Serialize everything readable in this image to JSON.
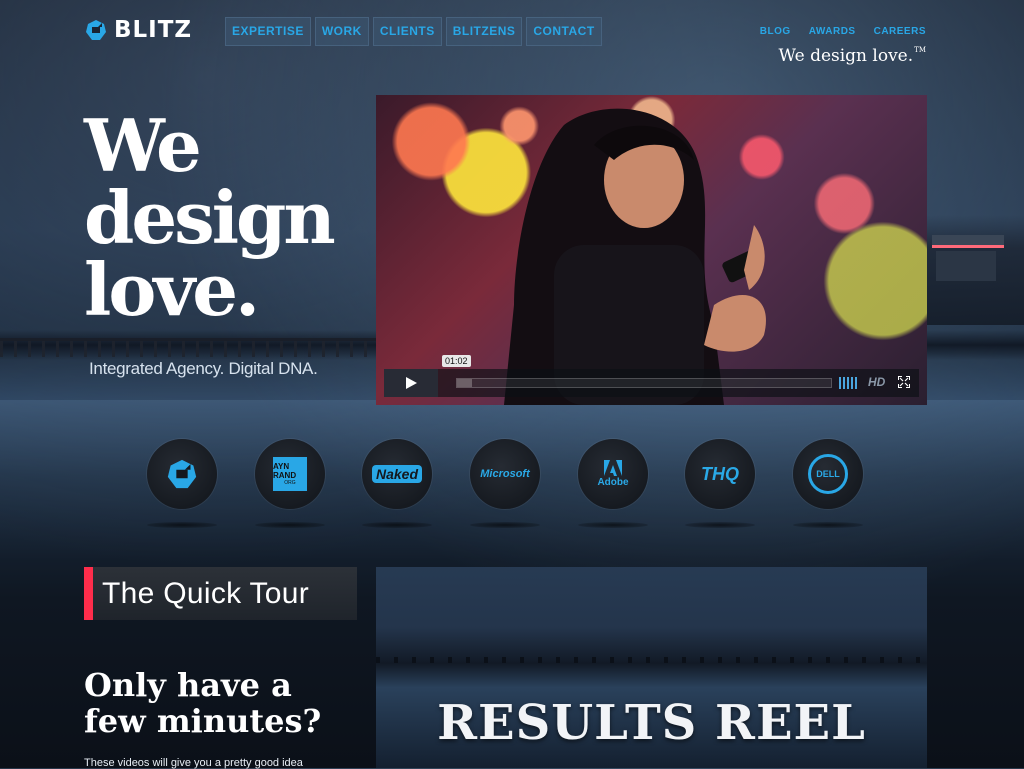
{
  "brand": {
    "name": "BLITZ",
    "tagline": "We design love.",
    "tagline_mark": "TM"
  },
  "nav": {
    "items": [
      {
        "label": "EXPERTISE"
      },
      {
        "label": "WORK"
      },
      {
        "label": "CLIENTS"
      },
      {
        "label": "BLITZENS"
      },
      {
        "label": "CONTACT"
      }
    ]
  },
  "top_nav": {
    "items": [
      {
        "label": "BLOG"
      },
      {
        "label": "AWARDS"
      },
      {
        "label": "CAREERS"
      }
    ]
  },
  "hero": {
    "headline_lines": [
      "We",
      "design",
      "love."
    ],
    "subheadline": "Integrated Agency. Digital DNA."
  },
  "video": {
    "current_time": "01:02",
    "progress_fraction": 0.04,
    "hd_label": "HD",
    "play_icon": "play-icon",
    "volume_icon": "volume-bars-icon",
    "fullscreen_icon": "fullscreen-icon"
  },
  "clients": [
    {
      "name": "Blitz",
      "label": ""
    },
    {
      "name": "Ayn Rand",
      "label": "AYN RAND",
      "sub": "ORG"
    },
    {
      "name": "Naked",
      "label": "Naked"
    },
    {
      "name": "Microsoft",
      "label": "Microsoft"
    },
    {
      "name": "Adobe",
      "label": "Adobe"
    },
    {
      "name": "THQ",
      "label": "THQ"
    },
    {
      "name": "Dell",
      "label": "DELL"
    }
  ],
  "quick_tour": {
    "title": "The Quick Tour",
    "heading_lines": [
      "Only have a",
      "few minutes?"
    ],
    "body": "These videos will give you a pretty good idea"
  },
  "reel": {
    "title": "RESULTS REEL"
  },
  "colors": {
    "accent_blue": "#29a7e6",
    "accent_red": "#ff2d4b"
  }
}
